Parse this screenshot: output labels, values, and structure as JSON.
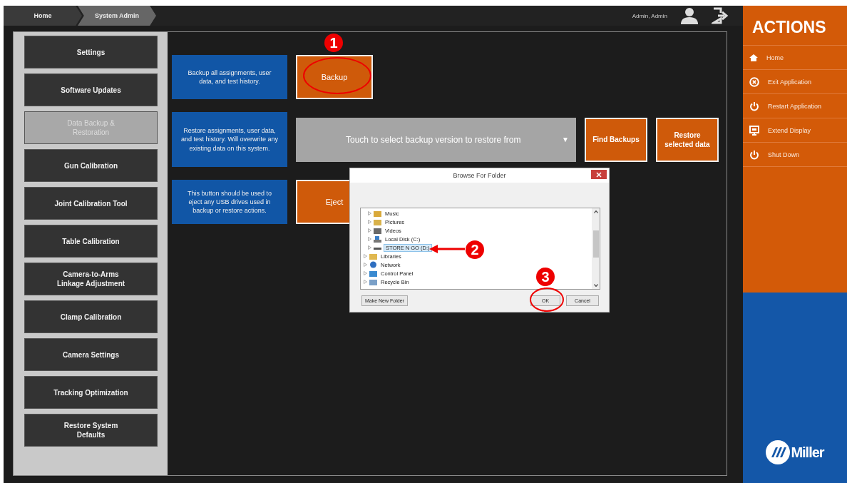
{
  "breadcrumbs": [
    {
      "label": "Home",
      "selected": false
    },
    {
      "label": "System Admin",
      "selected": true
    }
  ],
  "user": {
    "name": "Admin, Admin"
  },
  "sidebar": {
    "items": [
      {
        "label": "Settings",
        "selected": false
      },
      {
        "label": "Software Updates",
        "selected": false
      },
      {
        "label": "Data Backup & Restoration",
        "selected": true
      },
      {
        "label": "Gun Calibration",
        "selected": false
      },
      {
        "label": "Joint Calibration Tool",
        "selected": false
      },
      {
        "label": "Table Calibration",
        "selected": false
      },
      {
        "label": "Camera-to-Arms Linkage Adjustment",
        "selected": false
      },
      {
        "label": "Clamp Calibration",
        "selected": false
      },
      {
        "label": "Camera Settings",
        "selected": false
      },
      {
        "label": "Tracking Optimization",
        "selected": false
      },
      {
        "label": "Restore System Defaults",
        "selected": false
      }
    ]
  },
  "backup": {
    "description": "Backup all assignments, user data, and test history.",
    "button": "Backup"
  },
  "restore": {
    "description": "Restore assignments, user data, and test history.  Will overwrite any existing data on this system.",
    "dropdown": "Touch to select backup version to restore from",
    "dropdown_arrow": "▼",
    "find_button": "Find Backups",
    "restore_button": "Restore selected data"
  },
  "eject": {
    "description": "This button should be used to eject any USB drives used in backup or restore actions.",
    "button": "Eject"
  },
  "dialog": {
    "title": "Browse For Folder",
    "tree": [
      {
        "children": [
          {
            "label": "Music",
            "kind": "music",
            "selected": false
          },
          {
            "label": "Pictures",
            "kind": "pictures",
            "selected": false
          },
          {
            "label": "Videos",
            "kind": "videos",
            "selected": false
          },
          {
            "label": "Local Disk (C:)",
            "kind": "disk",
            "selected": false
          },
          {
            "label": "STORE N GO (D:)",
            "kind": "usb",
            "selected": true
          }
        ]
      },
      {
        "label": "Libraries",
        "kind": "libraries",
        "selected": false
      },
      {
        "label": "Network",
        "kind": "network",
        "selected": false
      },
      {
        "label": "Control Panel",
        "kind": "panel",
        "selected": false
      },
      {
        "label": "Recycle Bin",
        "kind": "bin",
        "selected": false
      }
    ],
    "buttons": [
      "Make New Folder",
      "OK",
      "Cancel"
    ]
  },
  "actions": {
    "title": "ACTIONS",
    "items": [
      {
        "label": "Home",
        "kind": "home"
      },
      {
        "label": "Exit Application",
        "kind": "exit"
      },
      {
        "label": "Restart Application",
        "kind": "power"
      },
      {
        "label": "Extend Display",
        "kind": "display"
      },
      {
        "label": "Shut Down",
        "kind": "power"
      }
    ],
    "logo": "Miller"
  },
  "annotations": [
    {
      "number": "1"
    },
    {
      "number": "2"
    },
    {
      "number": "3"
    }
  ]
}
